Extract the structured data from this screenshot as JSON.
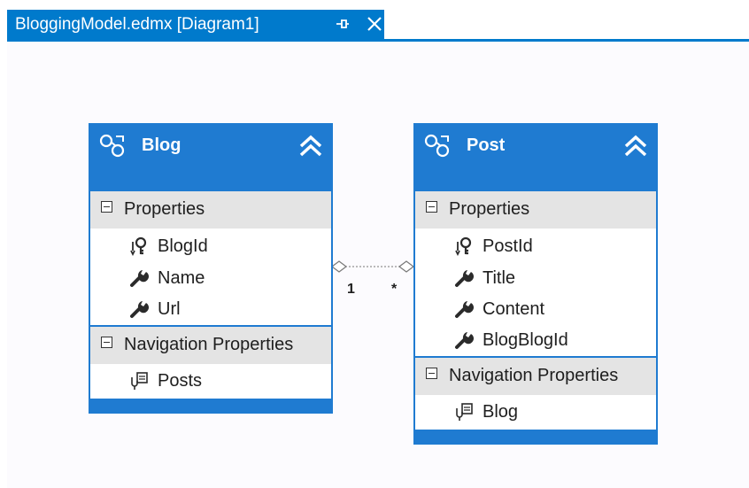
{
  "tab": {
    "title": "BloggingModel.edmx [Diagram1]"
  },
  "entities": {
    "blog": {
      "name": "Blog",
      "properties_label": "Properties",
      "properties": [
        "BlogId",
        "Name",
        "Url"
      ],
      "navigation_label": "Navigation Properties",
      "navigation": [
        "Posts"
      ]
    },
    "post": {
      "name": "Post",
      "properties_label": "Properties",
      "properties": [
        "PostId",
        "Title",
        "Content",
        "BlogBlogId"
      ],
      "navigation_label": "Navigation Properties",
      "navigation": [
        "Blog"
      ]
    }
  },
  "association": {
    "left_multiplicity": "1",
    "right_multiplicity": "*"
  },
  "icons": {
    "entity": "entity-icon",
    "collapse": "double-chevron-up-icon",
    "key": "key-icon",
    "property": "wrench-icon",
    "navigation": "navigation-property-icon"
  },
  "colors": {
    "accent": "#1f7bd1",
    "tab": "#007acc",
    "section": "#e4e4e4",
    "canvas": "#fcfbfe"
  }
}
